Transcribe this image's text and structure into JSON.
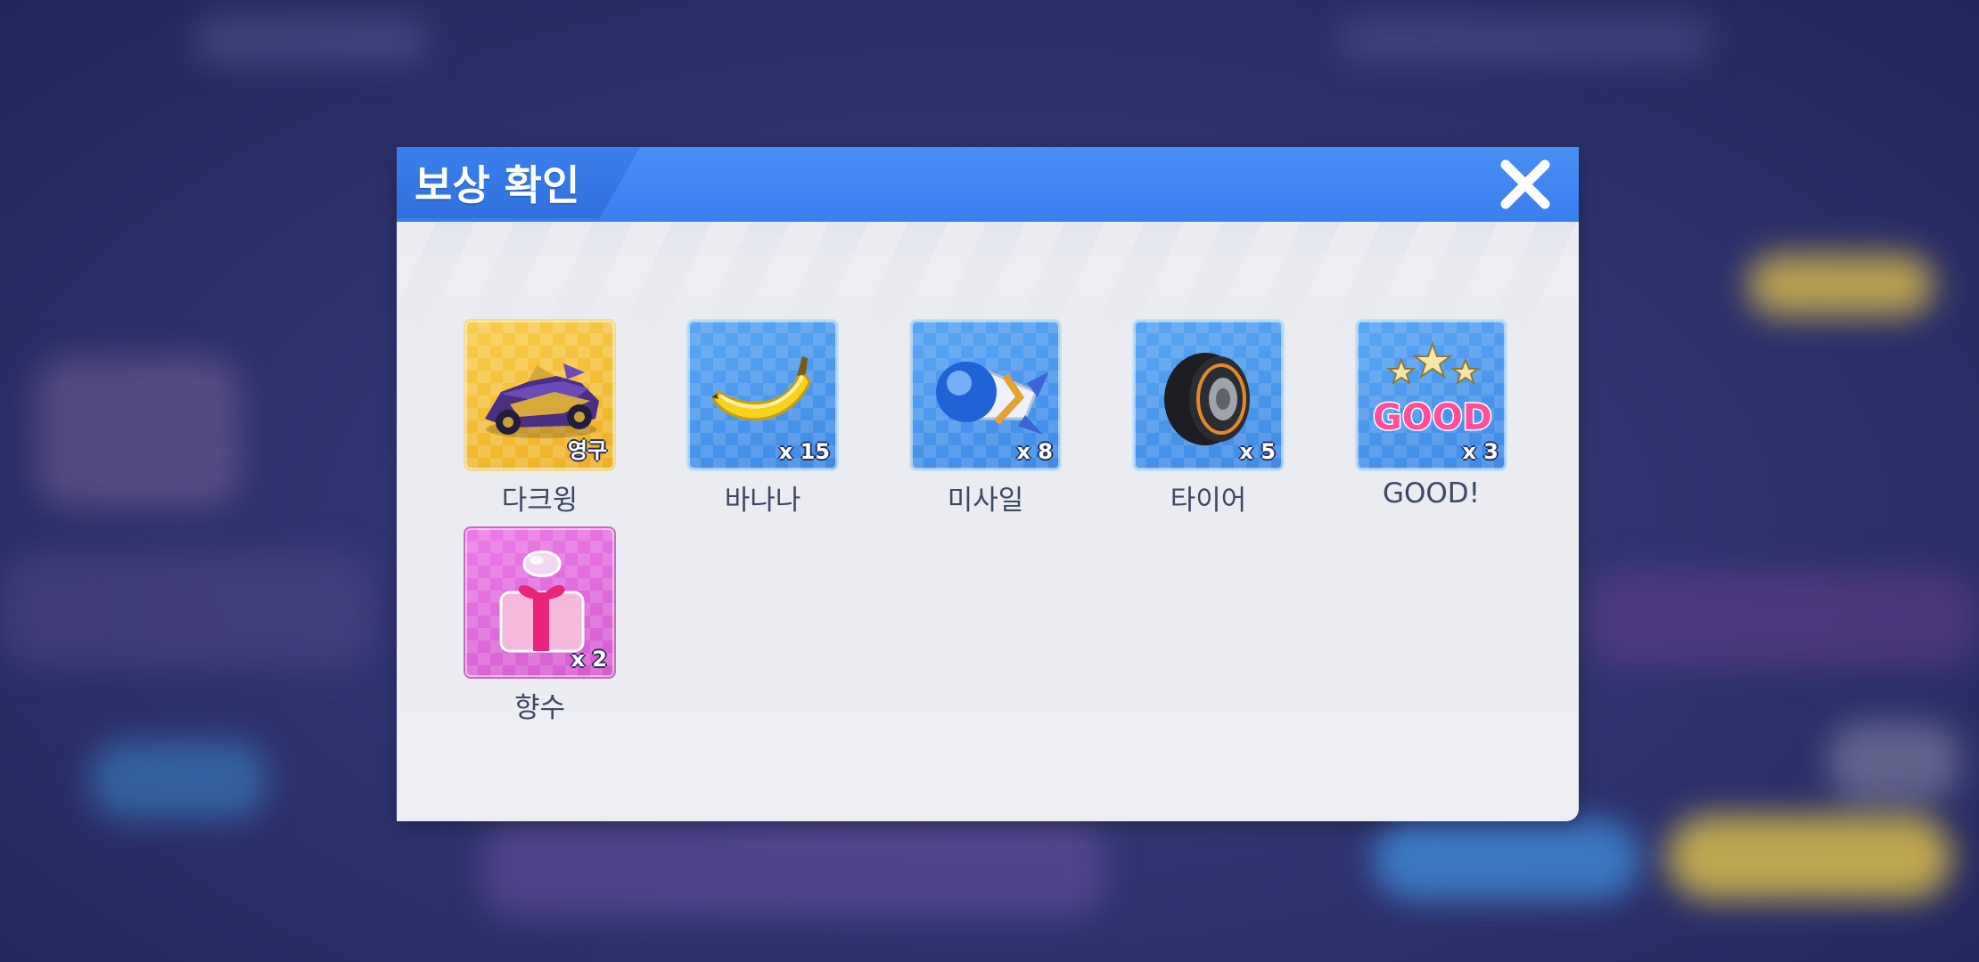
{
  "dialog": {
    "title": "보상 확인",
    "close_icon": "close-icon"
  },
  "rewards": [
    {
      "name": "다크윙",
      "quantity": "영구",
      "icon": "kart-icon",
      "tile_color": "gold"
    },
    {
      "name": "바나나",
      "quantity": "x 15",
      "icon": "banana-icon",
      "tile_color": "blue"
    },
    {
      "name": "미사일",
      "quantity": "x 8",
      "icon": "missile-icon",
      "tile_color": "blue"
    },
    {
      "name": "타이어",
      "quantity": "x 5",
      "icon": "tire-icon",
      "tile_color": "blue"
    },
    {
      "name": "GOOD!",
      "quantity": "x 3",
      "icon": "good-sticker-icon",
      "tile_color": "blue"
    },
    {
      "name": "향수",
      "quantity": "x 2",
      "icon": "perfume-gift-icon",
      "tile_color": "pink"
    }
  ],
  "colors": {
    "header_blue": "#3a7ef0",
    "dialog_bg": "#eceef3",
    "label_text": "#3e4863"
  }
}
